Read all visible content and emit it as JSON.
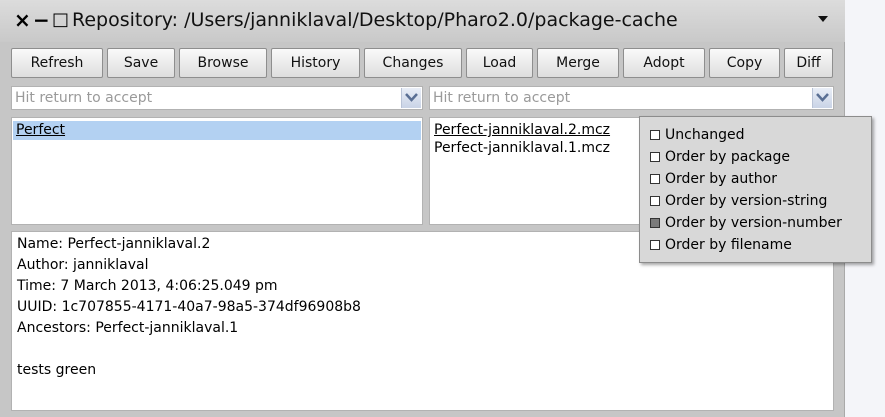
{
  "window": {
    "title": "Repository: /Users/janniklaval/Desktop/Pharo2.0/package-cache",
    "close_glyph": "×",
    "minimize_glyph": "−",
    "maximize_glyph": "□",
    "menu_glyph": "▾"
  },
  "toolbar": {
    "buttons": [
      "Refresh",
      "Save",
      "Browse",
      "History",
      "Changes",
      "Load",
      "Merge",
      "Adopt",
      "Copy",
      "Diff"
    ]
  },
  "filters": {
    "left_placeholder": "Hit return to accept",
    "right_placeholder": "Hit return to accept"
  },
  "packages": {
    "items": [
      "Perfect"
    ],
    "selected": "Perfect"
  },
  "versions": {
    "items": [
      "Perfect-janniklaval.2.mcz",
      "Perfect-janniklaval.1.mcz"
    ]
  },
  "details": {
    "lines": [
      "Name: Perfect-janniklaval.2",
      "Author: janniklaval",
      "Time: 7 March 2013, 4:06:25.049 pm",
      "UUID: 1c707855-4171-40a7-98a5-374df96908b8",
      "Ancestors: Perfect-janniklaval.1",
      "",
      "tests green"
    ]
  },
  "order_menu": {
    "options": [
      {
        "label": "Unchanged",
        "checked": false
      },
      {
        "label": "Order by package",
        "checked": false
      },
      {
        "label": "Order by author",
        "checked": false
      },
      {
        "label": "Order by version-string",
        "checked": false
      },
      {
        "label": "Order by version-number",
        "checked": true
      },
      {
        "label": "Order by filename",
        "checked": false
      }
    ]
  },
  "colors": {
    "selection": "#b3d1f2",
    "window_bg": "#c6c6c6",
    "desktop_bg": "#f4f5f9"
  }
}
